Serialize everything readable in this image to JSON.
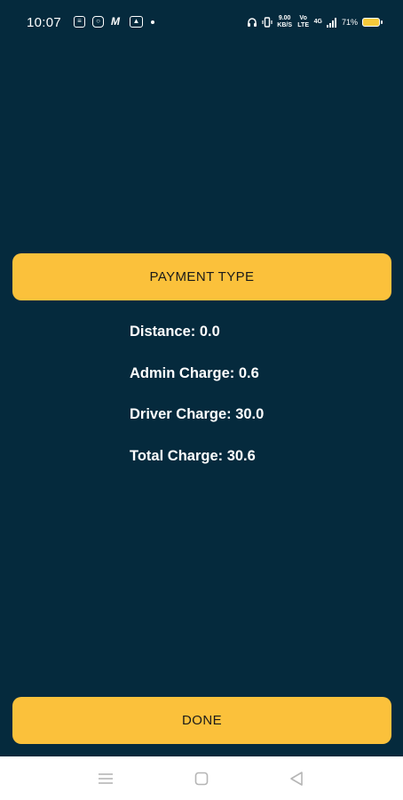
{
  "status_bar": {
    "time": "10:07",
    "app_icons": [
      "notes-icon",
      "instagram-icon",
      "m-app-icon",
      "gallery-icon"
    ],
    "network_speed": "9.00 KB/S",
    "network_type": "Vo LTE",
    "signal": "4G",
    "battery_percent": "71%"
  },
  "payment_button": {
    "label": "PAYMENT TYPE"
  },
  "charges": {
    "distance": "Distance: 0.0",
    "admin_charge": "Admin Charge: 0.6",
    "driver_charge": "Driver Charge: 30.0",
    "total_charge": "Total Charge: 30.6"
  },
  "done_button": {
    "label": "DONE"
  },
  "nav_bar": {
    "icons": [
      "menu-icon",
      "home-icon",
      "back-icon"
    ]
  },
  "colors": {
    "background": "#052a3d",
    "accent": "#fbc13b",
    "text": "#ffffff"
  }
}
